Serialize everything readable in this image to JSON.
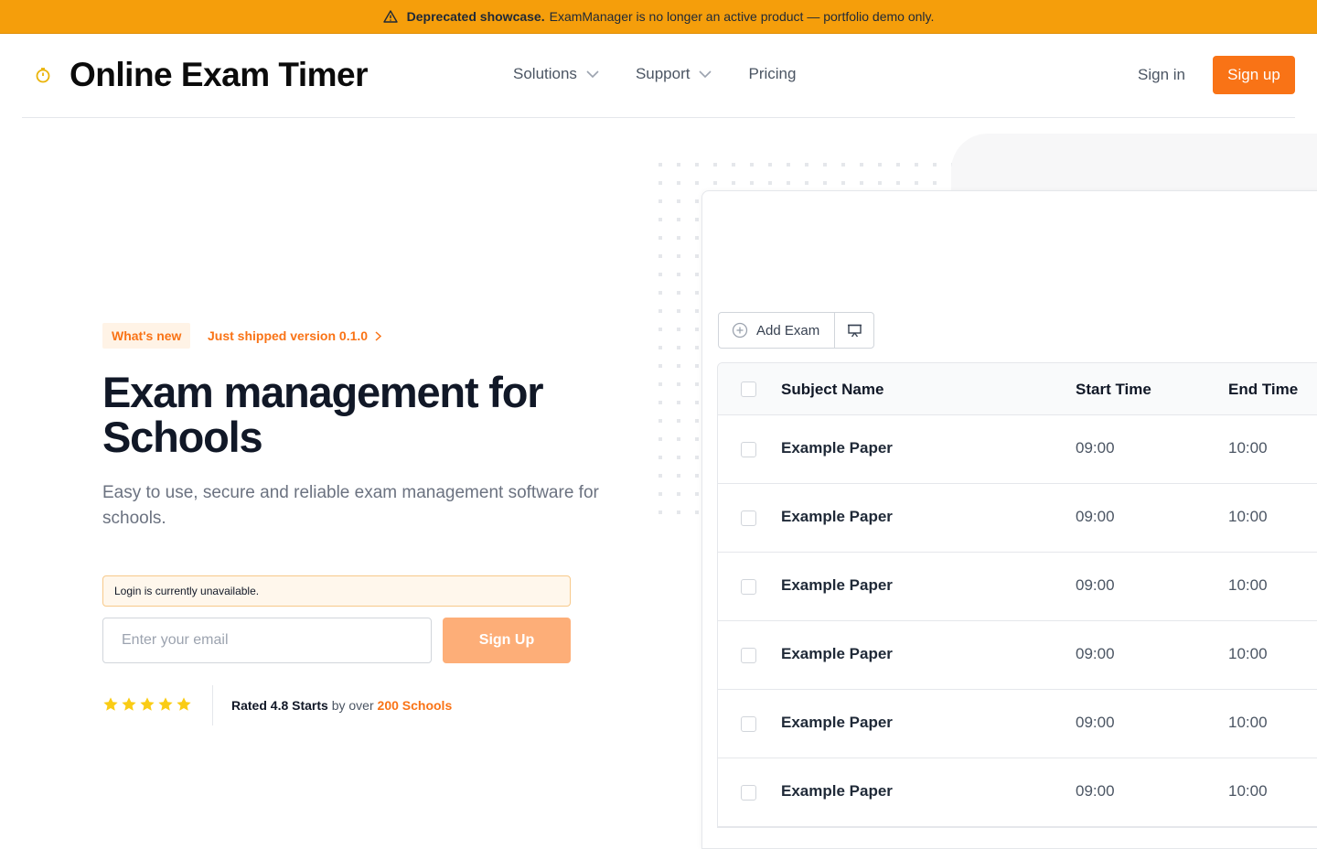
{
  "banner": {
    "icon": "warning-triangle-icon",
    "strong": "Deprecated showcase.",
    "text": "ExamManager is no longer an active product — portfolio demo only."
  },
  "header": {
    "logo_icon": "stopwatch-icon",
    "logo_text": "Online Exam Timer",
    "nav": [
      {
        "label": "Solutions",
        "has_dropdown": true
      },
      {
        "label": "Support",
        "has_dropdown": true
      },
      {
        "label": "Pricing",
        "has_dropdown": false
      }
    ],
    "signin": "Sign in",
    "signup": "Sign up"
  },
  "hero": {
    "badge": "What's new",
    "shipped": "Just shipped version 0.1.0",
    "title": "Exam management for Schools",
    "subtitle": "Easy to use, secure and reliable exam management software for schools.",
    "alert": "Login is currently unavailable.",
    "email_placeholder": "Enter your email",
    "signup_button": "Sign Up",
    "stars": 5,
    "rating_prefix": "Rated 4.8 Starts",
    "rating_mid": "by over",
    "rating_suffix": "200 Schools"
  },
  "preview": {
    "add_exam": "Add Exam",
    "present_icon": "presentation-icon",
    "columns": [
      "Subject Name",
      "Start Time",
      "End Time"
    ],
    "rows": [
      {
        "subject": "Example Paper",
        "start": "09:00",
        "end": "10:00"
      },
      {
        "subject": "Example Paper",
        "start": "09:00",
        "end": "10:00"
      },
      {
        "subject": "Example Paper",
        "start": "09:00",
        "end": "10:00"
      },
      {
        "subject": "Example Paper",
        "start": "09:00",
        "end": "10:00"
      },
      {
        "subject": "Example Paper",
        "start": "09:00",
        "end": "10:00"
      },
      {
        "subject": "Example Paper",
        "start": "09:00",
        "end": "10:00"
      }
    ]
  },
  "colors": {
    "banner": "#f59e0b",
    "accent": "#f97316",
    "accent_light": "#fdae78",
    "star": "#facc15"
  }
}
